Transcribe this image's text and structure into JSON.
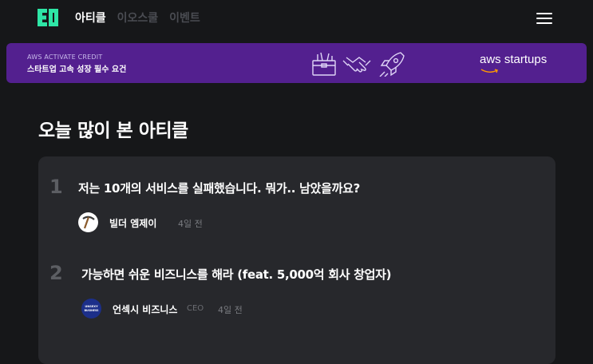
{
  "nav": {
    "logo_icon": "eo-logo-icon",
    "tabs": [
      {
        "label": "아티클",
        "active": true
      },
      {
        "label": "이오스쿨",
        "active": false
      },
      {
        "label": "이벤트",
        "active": false
      }
    ],
    "menu_icon": "hamburger-menu-icon"
  },
  "banner": {
    "subtitle": "AWS ACTIVATE CREDIT",
    "title": "스타트업 고속 성장 필수 요건",
    "brand": "aws startups",
    "icons": [
      "toolbox-icon",
      "handshake-icon",
      "rocket-icon"
    ],
    "background": "#53208f"
  },
  "section": {
    "title": "오늘 많이 본 아티클"
  },
  "articles": [
    {
      "rank": "1",
      "title": "저는 10개의 서비스를 실패했습니다. 뭐가.. 남았을까요?",
      "author": "빌더 엠제이",
      "role": "",
      "time": "4일 전",
      "avatar_icon": "pickaxe-avatar-icon"
    },
    {
      "rank": "2",
      "title": "가능하면 쉬운 비즈니스를 해라 (feat. 5,000억 회사 창업자)",
      "author": "언섹시 비즈니스",
      "role": "CEO",
      "time": "4일 전",
      "avatar_icon": "unsexy-business-logo-icon",
      "avatar_text": "UNSEXY BUSINESS"
    }
  ],
  "colors": {
    "background": "#161719",
    "card": "#27282c",
    "logo": "#2ee6a6",
    "inactive_tab": "#4a4c52"
  }
}
